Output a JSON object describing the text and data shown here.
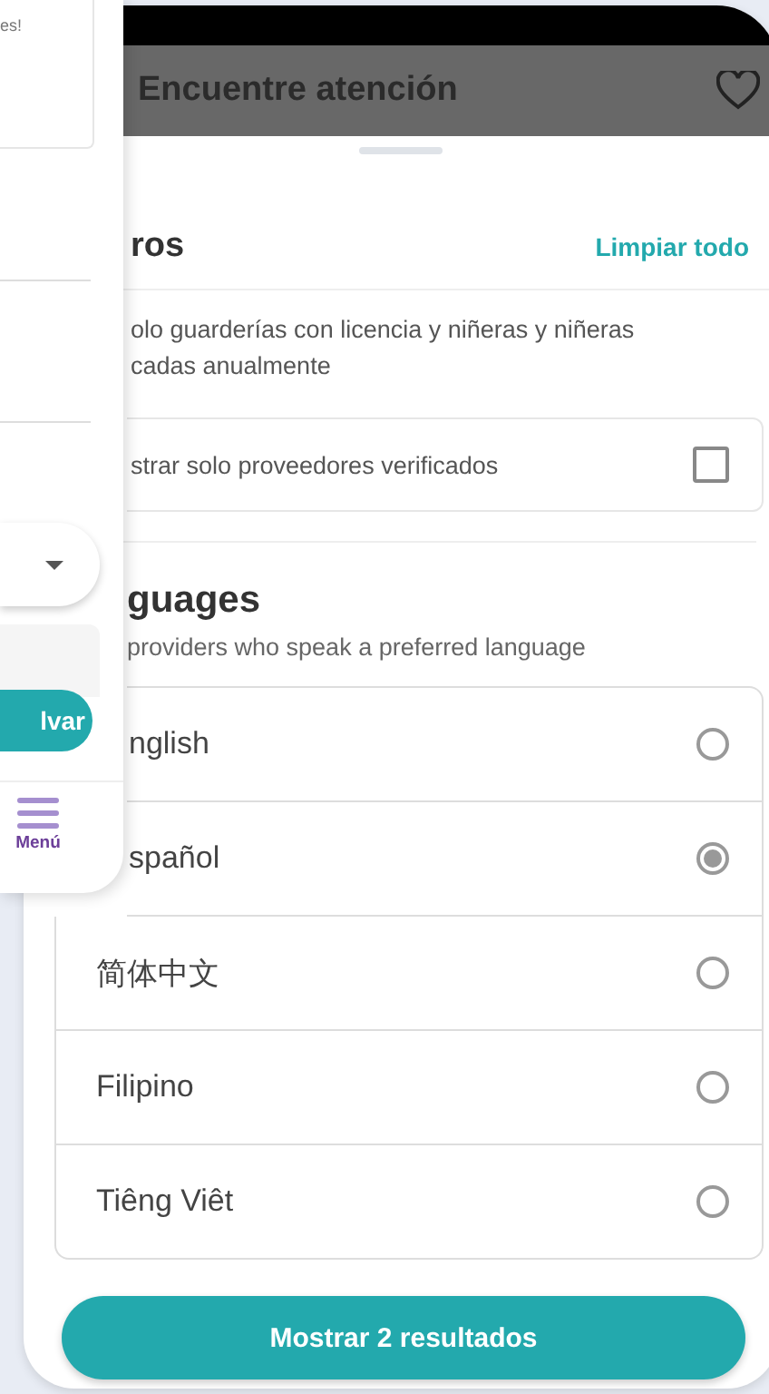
{
  "left_screen": {
    "notice_text": "es!",
    "save_button": "lvar",
    "nav": {
      "label": "Menú"
    }
  },
  "right_screen": {
    "header": {
      "title": "Encuentre atención"
    },
    "filters": {
      "title": "ros",
      "clear_all": "Limpiar todo",
      "verified_description": "olo guarderías con licencia y niñeras y niñeras cadas anualmente",
      "verified_option": {
        "label": "strar solo proveedores verificados",
        "checked": false
      }
    },
    "languages": {
      "title": "guages",
      "subtitle": "providers who speak a preferred language",
      "options": [
        {
          "label": "nglish",
          "selected": false
        },
        {
          "label": "spañol",
          "selected": true
        },
        {
          "label": "简体中文",
          "selected": false
        },
        {
          "label": "Filipino",
          "selected": false
        },
        {
          "label": "Tiêng Viêt",
          "selected": false
        }
      ]
    },
    "submit_button": "Mostrar 2 resultados"
  }
}
